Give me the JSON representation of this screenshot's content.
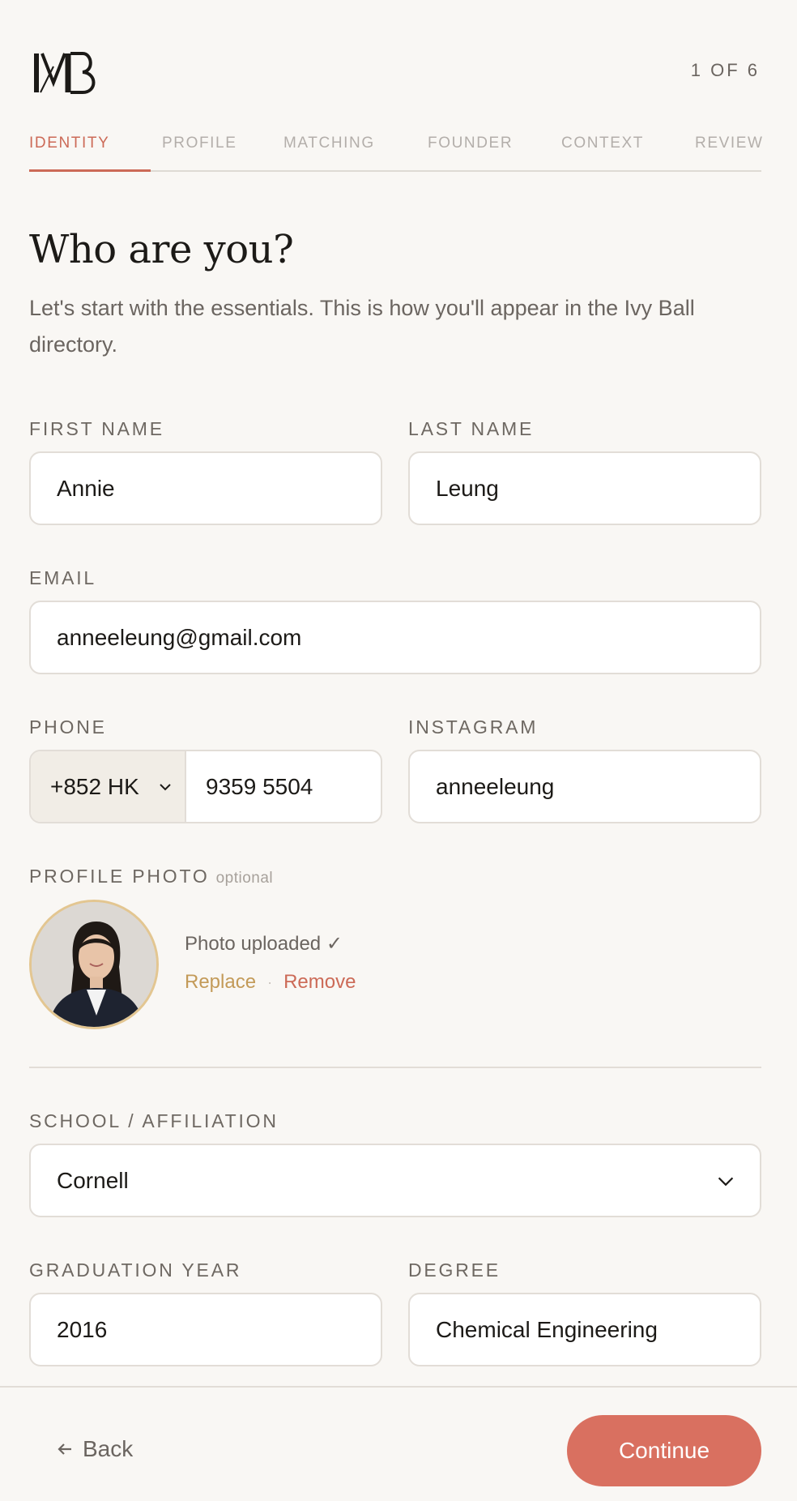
{
  "header": {
    "logo_text": "IVB",
    "step_counter": "1 OF 6"
  },
  "tabs": [
    {
      "label": "IDENTITY",
      "active": true
    },
    {
      "label": "PROFILE",
      "active": false
    },
    {
      "label": "MATCHING",
      "active": false
    },
    {
      "label": "FOUNDER",
      "active": false
    },
    {
      "label": "CONTEXT",
      "active": false
    },
    {
      "label": "REVIEW",
      "active": false
    }
  ],
  "intro": {
    "heading": "Who are you?",
    "subtitle": "Let's start with the essentials. This is how you'll appear in the Ivy Ball directory."
  },
  "form": {
    "first_name": {
      "label": "FIRST NAME",
      "value": "Annie"
    },
    "last_name": {
      "label": "LAST NAME",
      "value": "Leung"
    },
    "email": {
      "label": "EMAIL",
      "value": "anneeleung@gmail.com"
    },
    "phone": {
      "label": "PHONE",
      "country": "+852 HK",
      "value": "9359 5504"
    },
    "instagram": {
      "label": "INSTAGRAM",
      "value": "anneeleung"
    },
    "profile_photo": {
      "label": "PROFILE PHOTO",
      "optional": "optional",
      "status": "Photo uploaded ✓",
      "replace": "Replace",
      "separator": "·",
      "remove": "Remove"
    },
    "school": {
      "label": "SCHOOL / AFFILIATION",
      "value": "Cornell"
    },
    "graduation_year": {
      "label": "GRADUATION YEAR",
      "value": "2016"
    },
    "degree": {
      "label": "DEGREE",
      "value": "Chemical Engineering"
    }
  },
  "footer": {
    "back_label": "Back",
    "continue_label": "Continue"
  },
  "colors": {
    "accent": "#cc6a57",
    "button": "#d97060",
    "gold": "#c39a58",
    "background": "#f9f7f4"
  }
}
